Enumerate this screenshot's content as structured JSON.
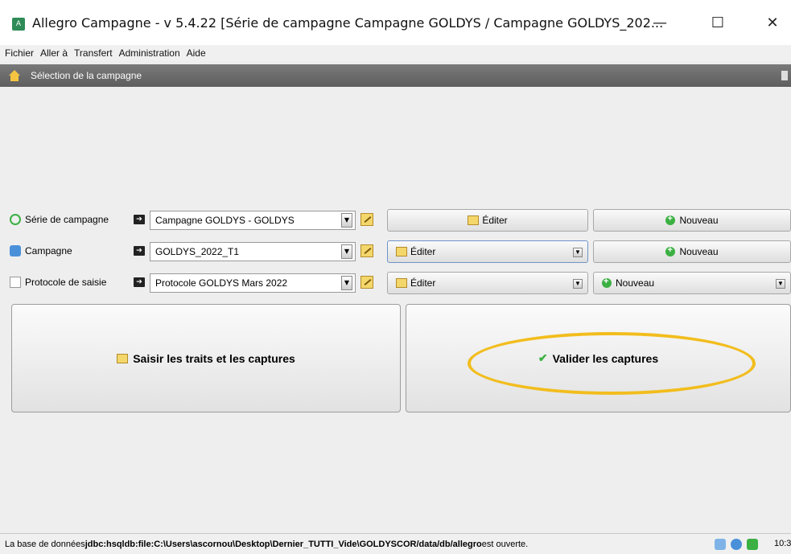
{
  "window": {
    "title": "Allegro Campagne - v 5.4.22 [Série de campagne Campagne GOLDYS / Campagne GOLDYS_202...",
    "minimize_glyph": "—",
    "maximize_glyph": "☐",
    "close_glyph": "✕"
  },
  "menubar": {
    "items": [
      "Fichier",
      "Aller à",
      "Transfert",
      "Administration",
      "Aide"
    ]
  },
  "section": {
    "title": "Sélection de la campagne"
  },
  "rows": [
    {
      "label": "Série de campagne",
      "icon": "series-icon",
      "value": "Campagne GOLDYS - GOLDYS",
      "edit_label": "Éditer",
      "new_label": "Nouveau"
    },
    {
      "label": "Campagne",
      "icon": "campaign-icon",
      "value": "GOLDYS_2022_T1",
      "edit_label": "Éditer",
      "new_label": "Nouveau"
    },
    {
      "label": "Protocole de saisie",
      "icon": "protocol-icon",
      "value": "Protocole GOLDYS Mars 2022",
      "edit_label": "Éditer",
      "new_label": "Nouveau"
    }
  ],
  "actions": {
    "saisir_label": "Saisir les traits et les captures",
    "valider_label": "Valider les captures"
  },
  "statusbar": {
    "prefix": "La base de données ",
    "db_path": "jdbc:hsqldb:file:C:\\Users\\ascornou\\Desktop\\Dernier_TUTTI_Vide\\GOLDYSCOR/data/db/allegro",
    "suffix": " est ouverte.",
    "time": "10:3"
  },
  "colors": {
    "highlight": "#f2bd1d",
    "header": "#6b6b6b"
  }
}
